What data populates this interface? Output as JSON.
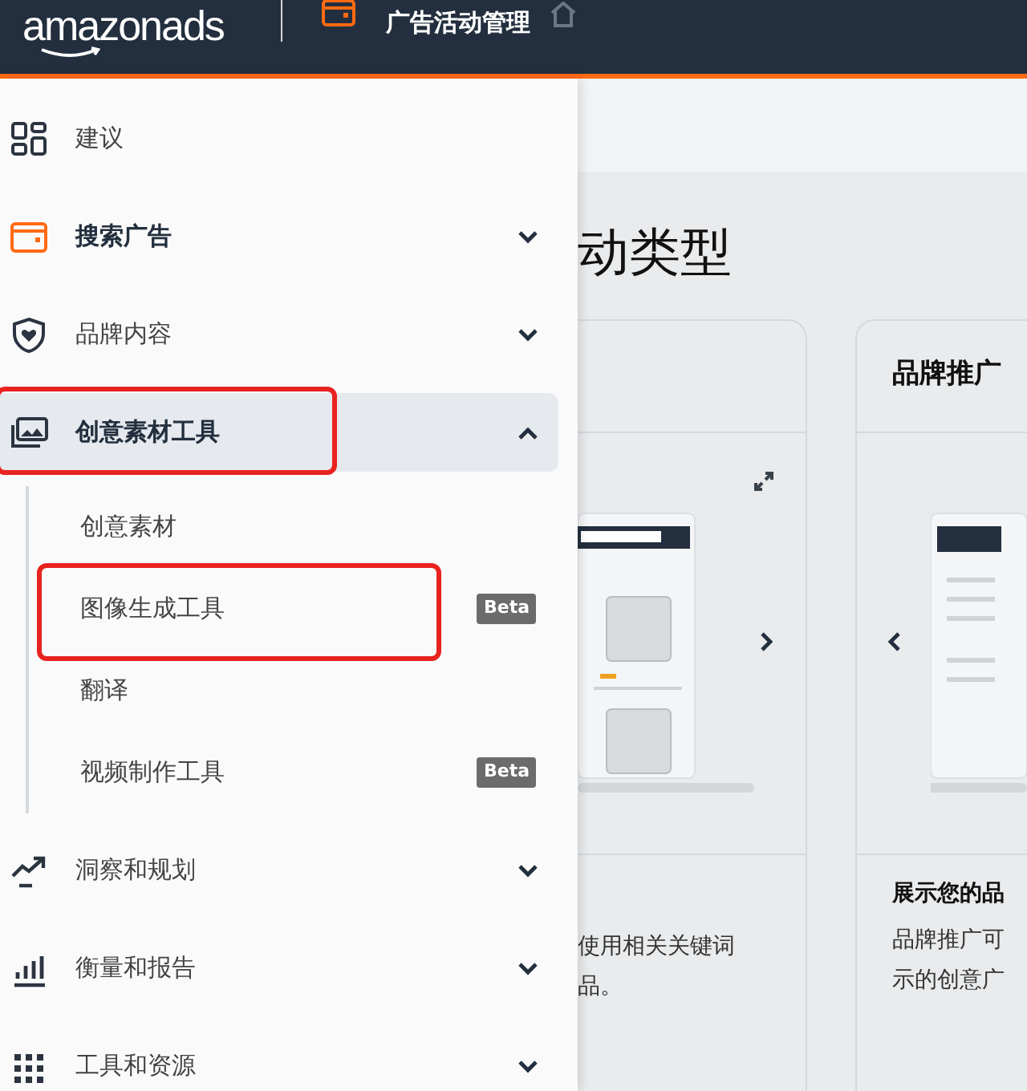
{
  "header": {
    "logo": "amazonads",
    "subtitle": "广告活动管理"
  },
  "sidebar": {
    "items": [
      {
        "label": "建议",
        "selected": false,
        "emphasized": false,
        "highlighted": false
      },
      {
        "label": "搜索广告",
        "selected": false,
        "emphasized": true,
        "highlighted": false,
        "expanded": false
      },
      {
        "label": "品牌内容",
        "selected": false,
        "emphasized": false,
        "highlighted": false,
        "expanded": false
      },
      {
        "label": "创意素材工具",
        "selected": true,
        "emphasized": true,
        "highlighted": true,
        "expanded": true,
        "children": [
          {
            "label": "创意素材",
            "highlighted": false
          },
          {
            "label": "图像生成工具",
            "highlighted": true,
            "badge": "Beta"
          },
          {
            "label": "翻译",
            "highlighted": false
          },
          {
            "label": "视频制作工具",
            "highlighted": false,
            "badge": "Beta"
          }
        ]
      },
      {
        "label": "洞察和规划",
        "selected": false,
        "emphasized": false,
        "highlighted": false,
        "expanded": false
      },
      {
        "label": "衡量和报告",
        "selected": false,
        "emphasized": false,
        "highlighted": false,
        "expanded": false
      },
      {
        "label": "工具和资源",
        "selected": false,
        "emphasized": false,
        "highlighted": false,
        "expanded": false
      }
    ]
  },
  "main": {
    "heading": "动类型",
    "cards": [
      {
        "description": [
          "使用相关关键词",
          "品。"
        ],
        "has_prev": false,
        "has_next": true
      },
      {
        "title": "品牌推广",
        "subtitle": "展示您的品",
        "description": [
          "品牌推广可",
          "示的创意广"
        ],
        "has_prev": true,
        "has_next": false
      }
    ]
  }
}
